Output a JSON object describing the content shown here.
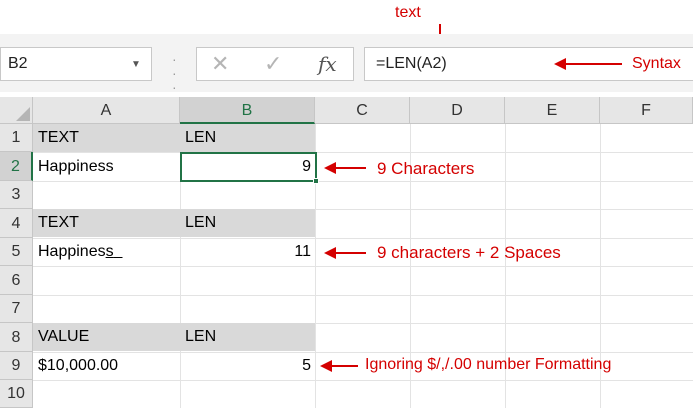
{
  "annotations": {
    "top": "text",
    "syntax": "Syntax",
    "row2": "9 Characters",
    "row5": "9 characters + 2 Spaces",
    "row9": "Ignoring $/,/.00 number Formatting"
  },
  "formula_bar": {
    "name_box": "B2",
    "fx": "fx",
    "formula": "=LEN(A2)"
  },
  "columns": [
    "A",
    "B",
    "C",
    "D",
    "E",
    "F"
  ],
  "rows": [
    "1",
    "2",
    "3",
    "4",
    "5",
    "6",
    "7",
    "8",
    "9",
    "10"
  ],
  "cells": {
    "a1": "TEXT",
    "b1": "LEN",
    "a2": "Happiness",
    "b2": "9",
    "a4": "TEXT",
    "b4": "LEN",
    "a5_base": "Happines",
    "a5_s": "s",
    "a5_sp": "  ",
    "b5": "11",
    "a8": "VALUE",
    "b8": "LEN",
    "a9": "$10,000.00",
    "b9": "5"
  },
  "colors": {
    "accent": "#217346",
    "annotation": "#d40000",
    "header_band": "#d9d9d9"
  }
}
